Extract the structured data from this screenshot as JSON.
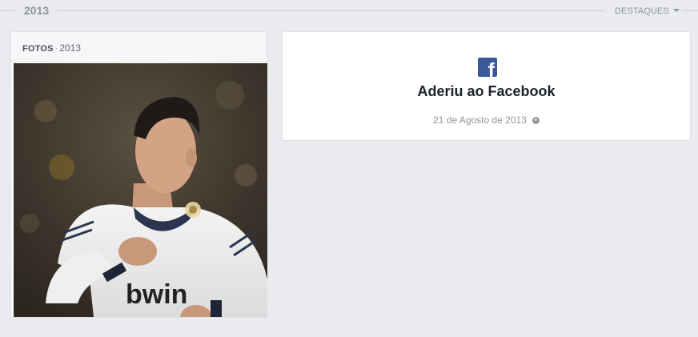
{
  "header": {
    "year": "2013",
    "highlights_label": "DESTAQUES"
  },
  "photos": {
    "label": "FOTOS",
    "separator": "·",
    "year": "2013",
    "photo_text": "bwin"
  },
  "life_event": {
    "icon": "facebook-icon",
    "title": "Aderiu ao Facebook",
    "date": "21 de Agosto de 2013",
    "privacy_icon": "globe-icon"
  },
  "colors": {
    "background": "#e9ebee",
    "facebook_blue": "#3b5998",
    "muted_text": "#90949c"
  }
}
